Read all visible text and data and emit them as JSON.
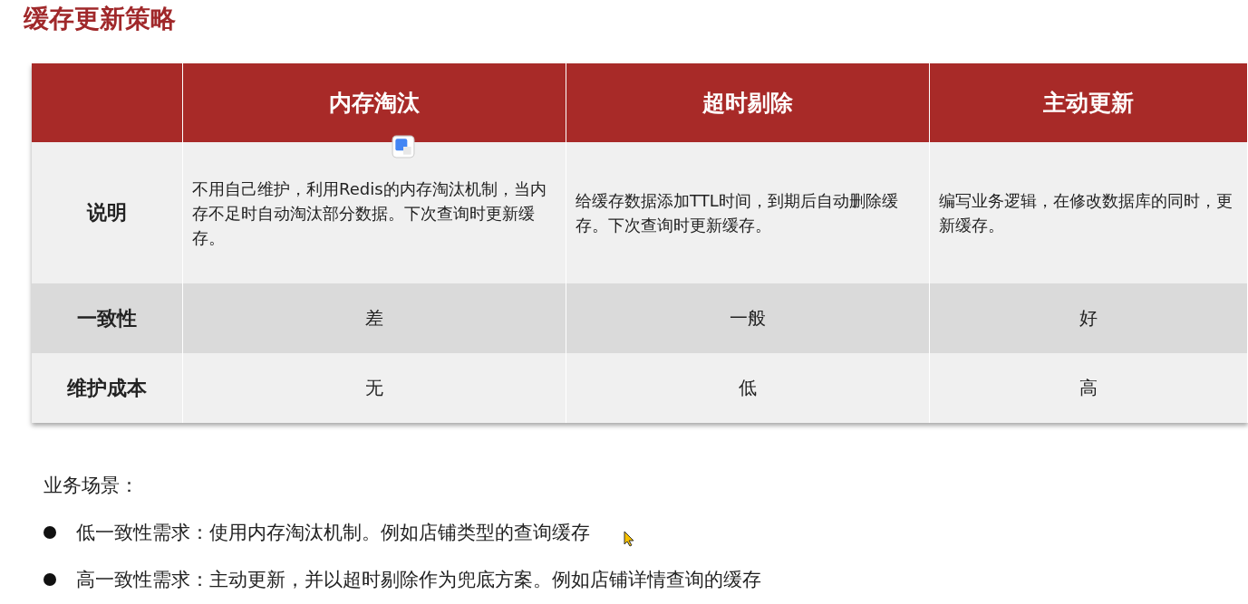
{
  "title": "缓存更新策略",
  "table": {
    "columns": [
      "",
      "内存淘汰",
      "超时剔除",
      "主动更新"
    ],
    "rows": [
      {
        "kind": "text",
        "cells": [
          "说明",
          "不用自己维护，利用Redis的内存淘汰机制，当内存不足时自动淘汰部分数据。下次查询时更新缓存。",
          "给缓存数据添加TTL时间，到期后自动删除缓存。下次查询时更新缓存。",
          "编写业务逻辑，在修改数据库的同时，更新缓存。"
        ]
      },
      {
        "kind": "value",
        "cells": [
          "一致性",
          "差",
          "一般",
          "好"
        ]
      },
      {
        "kind": "value",
        "cells": [
          "维护成本",
          "无",
          "低",
          "高"
        ]
      }
    ]
  },
  "scenarios": {
    "heading": "业务场景：",
    "items": [
      "低一致性需求：使用内存淘汰机制。例如店铺类型的查询缓存",
      "高一致性需求：主动更新，并以超时剔除作为兜底方案。例如店铺详情查询的缓存"
    ]
  }
}
